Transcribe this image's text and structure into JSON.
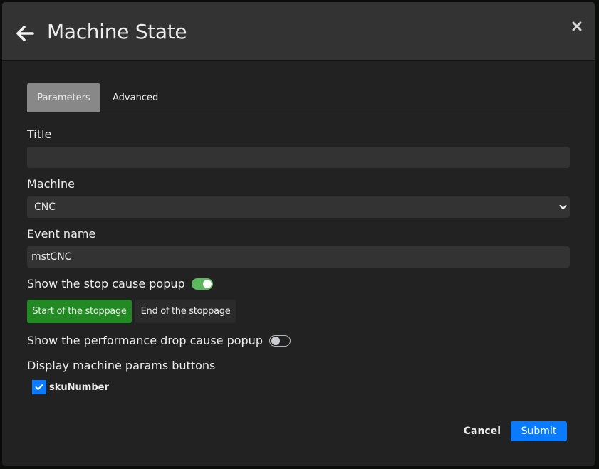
{
  "header": {
    "title": "Machine State",
    "back_icon": "arrow-left-icon",
    "close_icon": "close-x-icon"
  },
  "tabs": [
    {
      "label": "Parameters",
      "active": true
    },
    {
      "label": "Advanced",
      "active": false
    }
  ],
  "form": {
    "title": {
      "label": "Title",
      "value": "",
      "placeholder": ""
    },
    "machine": {
      "label": "Machine",
      "selected": "CNC"
    },
    "event_name": {
      "label": "Event name",
      "value": "mstCNC"
    },
    "stop_cause_popup": {
      "label": "Show the stop cause popup",
      "enabled": true
    },
    "stoppage_buttons": [
      {
        "label": "Start of the stoppage",
        "selected": true
      },
      {
        "label": "End of the stoppage",
        "selected": false
      }
    ],
    "performance_drop_popup": {
      "label": "Show the performance drop cause popup",
      "enabled": false
    },
    "machine_params": {
      "label": "Display machine params buttons",
      "options": [
        {
          "label": "skuNumber",
          "checked": true
        }
      ]
    }
  },
  "footer": {
    "cancel_label": "Cancel",
    "submit_label": "Submit"
  },
  "colors": {
    "accent_blue": "#0a7bff",
    "selected_green": "#218a22",
    "toggle_on": "#5cb85c"
  }
}
